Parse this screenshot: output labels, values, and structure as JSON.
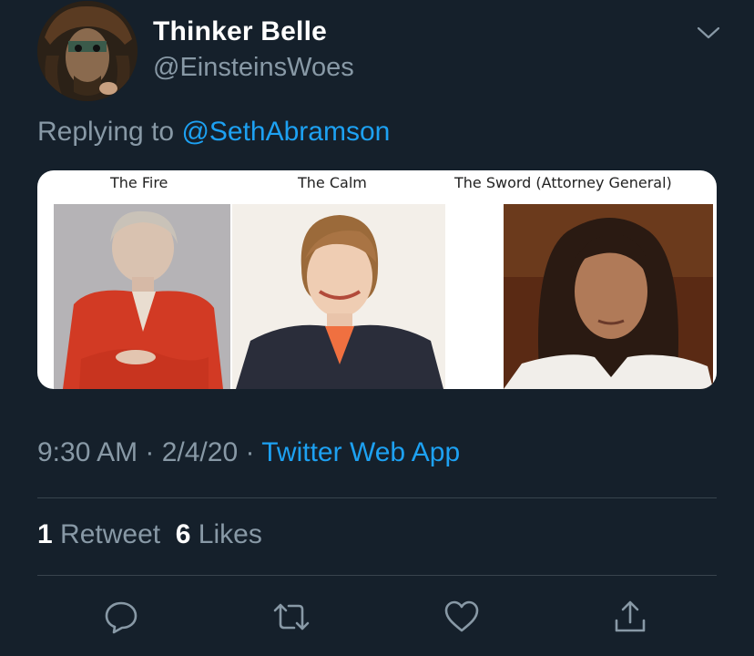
{
  "tweet": {
    "author_name": "Thinker Belle",
    "author_handle": "@EinsteinsWoes",
    "replying_prefix": "Replying to",
    "replying_to": "@SethAbramson",
    "timestamp": "9:30 AM · 2/4/20 ·",
    "source": "Twitter Web App",
    "retweet_count": "1",
    "retweet_label": "Retweet",
    "like_count": "6",
    "like_label": "Likes"
  },
  "media": {
    "captions": [
      "The Fire",
      "The Calm",
      "The Sword (Attorney General)"
    ]
  },
  "actions": {
    "icons": [
      "reply-icon",
      "retweet-icon",
      "like-icon",
      "share-icon"
    ]
  },
  "colors": {
    "background": "#15202b",
    "accent": "#1da1f2",
    "secondary_text": "#8899a6",
    "divider": "#38444d"
  }
}
